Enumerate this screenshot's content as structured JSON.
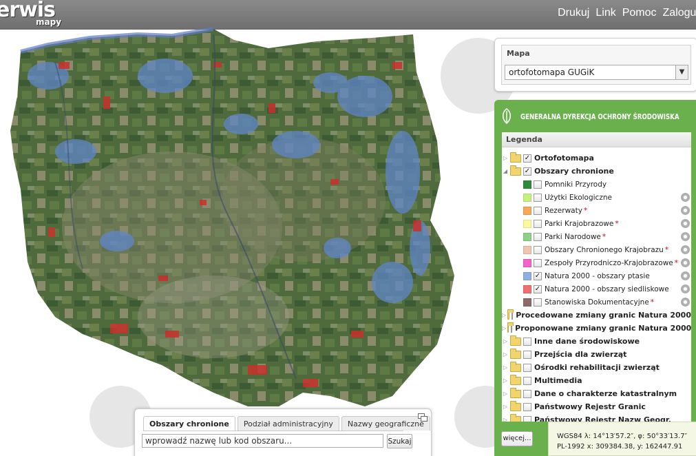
{
  "header": {
    "logo_main": "erwis",
    "logo_sub": "mapy",
    "nav": [
      "Drukuj",
      "Link",
      "Pomoc",
      "Zaloguj"
    ]
  },
  "map_panel": {
    "title": "Mapa",
    "selected": "ortofotomapa GUGiK"
  },
  "gdos_panel": {
    "title": "GENERALNA DYREKCJA OCHRONY ŚRODOWISKA",
    "accent": "#6ab04c"
  },
  "legend": {
    "title": "Legenda",
    "items": [
      {
        "label": "Ortofotomapa",
        "type": "group",
        "expanded": false,
        "checked": true
      },
      {
        "label": "Obszary chronione",
        "type": "group",
        "expanded": true,
        "checked": true
      },
      {
        "label": "Pomniki Przyrody",
        "type": "layer",
        "swatch": "icon",
        "checked": false,
        "required": false,
        "gear": false
      },
      {
        "label": "Użytki Ekologiczne",
        "type": "layer",
        "swatch": "#c6f07e",
        "checked": false,
        "required": false,
        "gear": true
      },
      {
        "label": "Rezerwaty",
        "type": "layer",
        "swatch": "#f7a95a",
        "checked": false,
        "required": true,
        "gear": true
      },
      {
        "label": "Parki Krajobrazowe",
        "type": "layer",
        "swatch": "#fdf79d",
        "checked": false,
        "required": true,
        "gear": true
      },
      {
        "label": "Parki Narodowe",
        "type": "layer",
        "swatch": "#8ed08a",
        "checked": false,
        "required": true,
        "gear": true
      },
      {
        "label": "Obszary Chronionego Krajobrazu",
        "type": "layer",
        "swatch": "#f0c5ad",
        "checked": false,
        "required": true,
        "gear": true
      },
      {
        "label": "Zespoły Przyrodniczo-Krajobrazowe",
        "type": "layer",
        "swatch": "#f562c9",
        "checked": false,
        "required": true,
        "gear": true
      },
      {
        "label": "Natura 2000 - obszary ptasie",
        "type": "layer",
        "swatch": "#8eaee4",
        "checked": true,
        "required": false,
        "gear": true
      },
      {
        "label": "Natura 2000 - obszary siedliskowe",
        "type": "layer",
        "swatch": "#f07070",
        "checked": true,
        "required": false,
        "gear": true
      },
      {
        "label": "Stanowiska Dokumentacyjne",
        "type": "layer",
        "swatch": "#8d6b6b",
        "checked": false,
        "required": true,
        "gear": true
      },
      {
        "label": "Procedowane zmiany granic Natura 2000",
        "type": "group",
        "expanded": false,
        "checked": false
      },
      {
        "label": "Proponowane zmiany granic Natura 2000",
        "type": "group",
        "expanded": false,
        "checked": false
      },
      {
        "label": "Inne dane środowiskowe",
        "type": "group",
        "expanded": false,
        "checked": false
      },
      {
        "label": "Przejścia dla zwierząt",
        "type": "group",
        "expanded": false,
        "checked": false
      },
      {
        "label": "Ośrodki rehabilitacji zwierząt",
        "type": "group",
        "expanded": false,
        "checked": false
      },
      {
        "label": "Multimedia",
        "type": "group",
        "expanded": false,
        "checked": false
      },
      {
        "label": "Dane o charakterze katastralnym",
        "type": "group",
        "expanded": false,
        "checked": false
      },
      {
        "label": "Państwowy Rejestr Granic",
        "type": "group",
        "expanded": false,
        "checked": false
      },
      {
        "label": "Państwowy Rejestr Nazw Geogr.",
        "type": "group",
        "expanded": false,
        "checked": false
      }
    ],
    "more_label": "więcej..."
  },
  "coords": {
    "line1": "WGS84  λ: 14°13′57.2″, φ: 50°33′13.7″",
    "line2": "PL-1992  x: 309384.38, y: 162447.91"
  },
  "search": {
    "tabs": [
      "Obszary chronione",
      "Podział administracyjny",
      "Nazwy geograficzne"
    ],
    "active_tab": 0,
    "placeholder": "wprowadź nazwę lub kod obszaru...",
    "button": "Szukaj"
  }
}
